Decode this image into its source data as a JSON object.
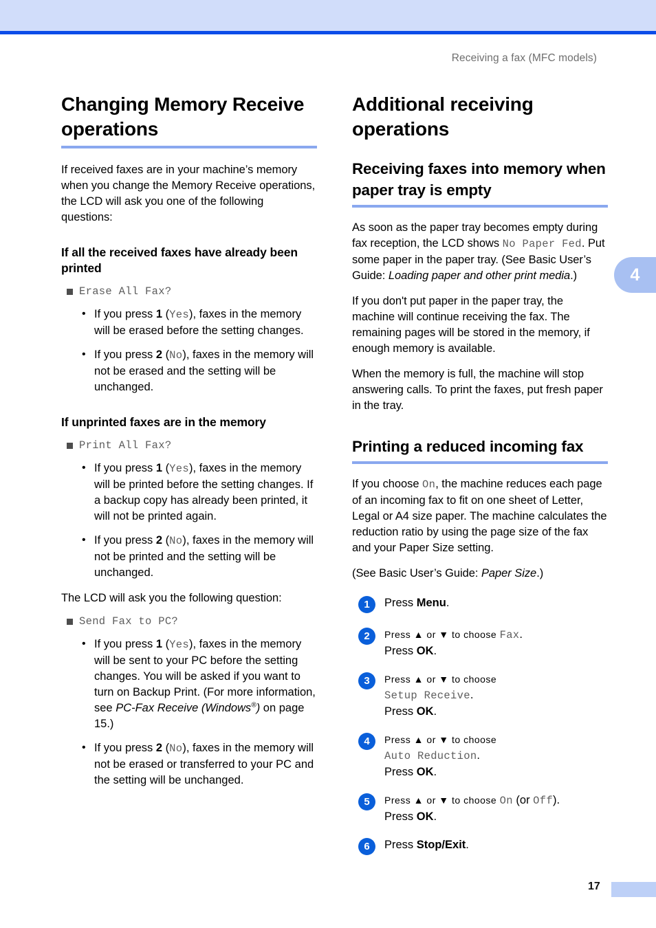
{
  "page": {
    "running_head": "Receiving a fax (MFC models)",
    "page_number": "17",
    "chapter_tab": "4",
    "accent_band": "#d1ddfa",
    "accent_rule": "#0b4ce8",
    "heading_rule": "#8aa8ef",
    "step_badge_color": "#0a5fda"
  },
  "left": {
    "section_title": "Changing Memory Receive operations",
    "intro": "If received faxes are in your machine’s memory when you change the Memory Receive operations, the LCD will ask you one of the following questions:",
    "group1": {
      "heading": "If all the received faxes have already been printed",
      "lcd_prompt": "Erase All Fax?",
      "options": [
        {
          "pre": "If you press ",
          "key": "1",
          "paren_open": " (",
          "lcd": "Yes",
          "paren_close": "), ",
          "rest": "faxes in the memory will be erased before the setting changes."
        },
        {
          "pre": "If you press ",
          "key": "2",
          "paren_open": " (",
          "lcd": "No",
          "paren_close": "), ",
          "rest": "faxes in the memory will not be erased and the setting will be unchanged."
        }
      ]
    },
    "group2": {
      "heading": "If unprinted faxes are in the memory",
      "lcd_prompt": "Print All Fax?",
      "options": [
        {
          "pre": "If you press ",
          "key": "1",
          "paren_open": " (",
          "lcd": "Yes",
          "paren_close": "), ",
          "rest": "faxes in the memory will be printed before the setting changes. If a backup copy has already been printed, it will not be printed again."
        },
        {
          "pre": "If you press ",
          "key": "2",
          "paren_open": " (",
          "lcd": "No",
          "paren_close": "), ",
          "rest": "faxes in the memory will not be printed and the setting will be unchanged."
        }
      ]
    },
    "lead_in": "The LCD will ask you the following question:",
    "group3": {
      "lcd_prompt": "Send Fax to PC?",
      "option_yes": {
        "pre": "If you press ",
        "key": "1",
        "paren_open": " (",
        "lcd": "Yes",
        "paren_close": "), ",
        "rest": "faxes in the memory will be sent to your PC before the setting changes. You will be asked if you want to turn on Backup Print. (For more information, see ",
        "ref_italic_a": "PC-Fax Receive (Windows",
        "ref_sup": "®",
        "ref_italic_b": ")",
        "tail": " on page 15.)"
      },
      "option_no": {
        "pre": "If you press ",
        "key": "2",
        "paren_open": " (",
        "lcd": "No",
        "paren_close": "), ",
        "rest": "faxes in the memory will not be erased or transferred to your PC and the setting will be unchanged."
      }
    }
  },
  "right": {
    "section_title": "Additional receiving operations",
    "sub1": {
      "heading": "Receiving faxes into memory when paper tray is empty",
      "para1_a": "As soon as the paper tray becomes empty during fax reception, the LCD shows ",
      "para1_lcd": "No Paper Fed",
      "para1_b": ". Put some paper in the paper tray. (See Basic User’s Guide: ",
      "para1_italic": "Loading paper and other print media",
      "para1_c": ".)",
      "para2": "If you don't put paper in the paper tray, the machine will continue receiving the fax. The remaining pages will be stored in the memory, if enough memory is available.",
      "para3": "When the memory is full, the machine will stop answering calls. To print the faxes, put fresh paper in the tray."
    },
    "sub2": {
      "heading": "Printing a reduced incoming fax",
      "para1_a": "If you choose ",
      "para1_lcd": "On",
      "para1_b": ", the machine reduces each page of an incoming fax to fit on one sheet of Letter, Legal or A4 size paper. The machine calculates the reduction ratio by using the page size of the fax and your Paper Size setting.",
      "para2_a": "(See Basic User’s Guide: ",
      "para2_italic": "Paper Size",
      "para2_b": ".)",
      "steps": [
        {
          "num": "1",
          "line1_a": "Press ",
          "line1_bold": "Menu",
          "line1_b": ".",
          "line2_lcd": "",
          "line3_a": "",
          "line3_bold": "",
          "line3_b": ""
        },
        {
          "num": "2",
          "line1_a": "Press ▲ or ▼ to choose ",
          "line1_lcd": "Fax",
          "line1_b": ".",
          "line3_a": "Press ",
          "line3_bold": "OK",
          "line3_b": "."
        },
        {
          "num": "3",
          "line1_a": "Press ▲ or ▼ to choose",
          "line2_lcd": "Setup Receive",
          "line2_b": ".",
          "line3_a": "Press ",
          "line3_bold": "OK",
          "line3_b": "."
        },
        {
          "num": "4",
          "line1_a": "Press ▲ or ▼ to choose",
          "line2_lcd": "Auto Reduction",
          "line2_b": ".",
          "line3_a": "Press ",
          "line3_bold": "OK",
          "line3_b": "."
        },
        {
          "num": "5",
          "line1_a": "Press ▲ or ▼ to choose ",
          "line1_lcd": "On",
          "line1_mid": " (or ",
          "line1_lcd2": "Off",
          "line1_b": ").",
          "line3_a": "Press ",
          "line3_bold": "OK",
          "line3_b": "."
        },
        {
          "num": "6",
          "line1_a": "Press ",
          "line1_bold": "Stop/Exit",
          "line1_b": "."
        }
      ]
    }
  }
}
